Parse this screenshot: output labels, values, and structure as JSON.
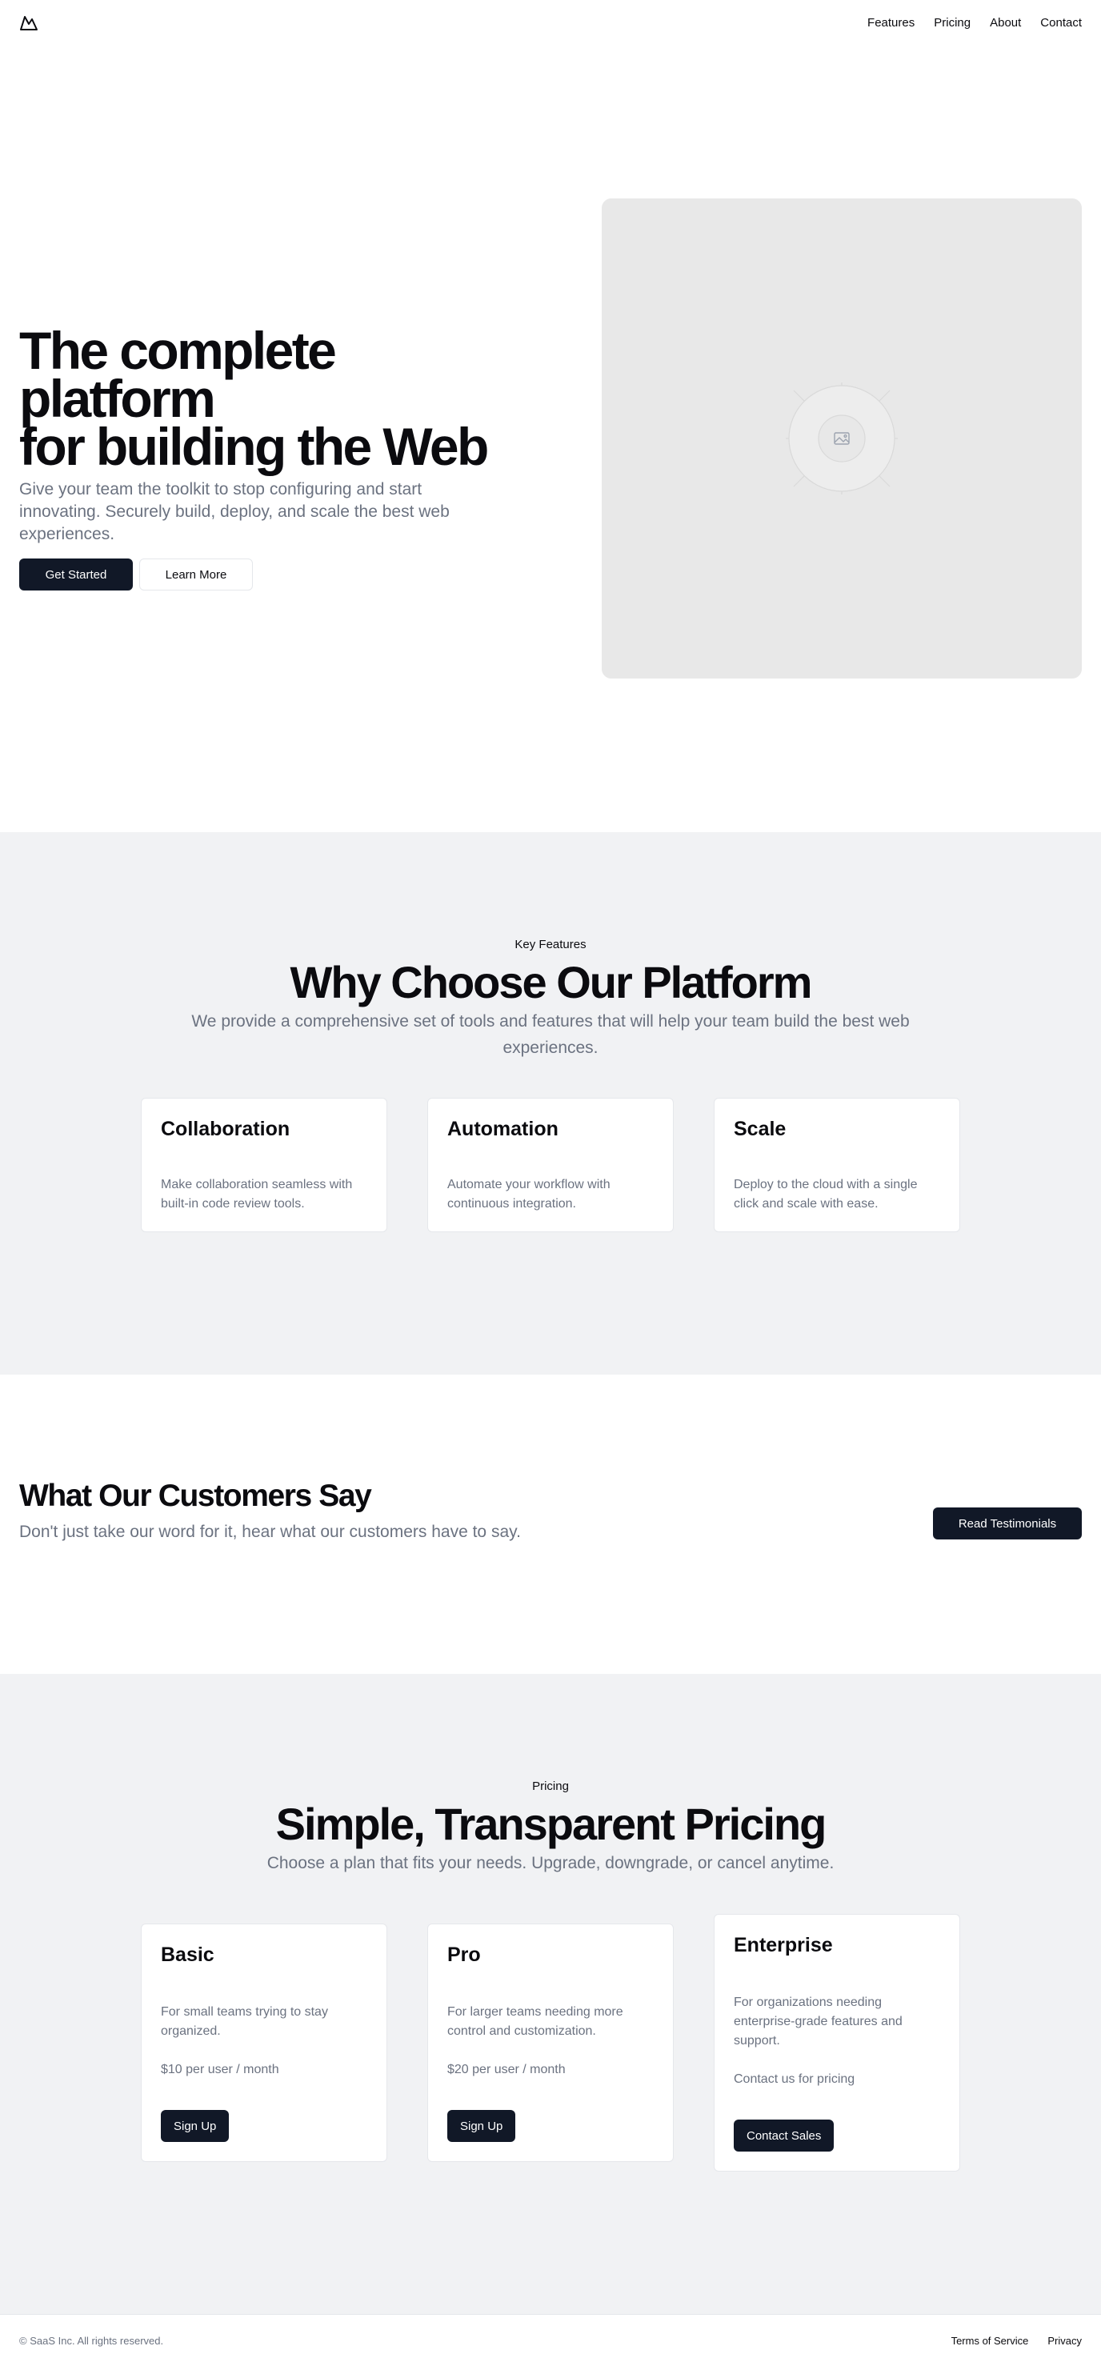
{
  "nav": {
    "logo_icon": "mountain-logo-icon",
    "items": [
      "Features",
      "Pricing",
      "About",
      "Contact"
    ]
  },
  "hero": {
    "title_line1": "The complete platform",
    "title_line2": "for building the Web",
    "subtitle": "Give your team the toolkit to stop configuring and start innovating. Securely build, deploy, and scale the best web experiences.",
    "primary_button": "Get Started",
    "secondary_button": "Learn More",
    "image_icon": "image-placeholder-icon"
  },
  "features": {
    "eyebrow": "Key Features",
    "title": "Why Choose Our Platform",
    "subtitle": "We provide a comprehensive set of tools and features that will help your team build the best web experiences.",
    "cards": [
      {
        "title": "Collaboration",
        "description": "Make collaboration seamless with built-in code review tools."
      },
      {
        "title": "Automation",
        "description": "Automate your workflow with continuous integration."
      },
      {
        "title": "Scale",
        "description": "Deploy to the cloud with a single click and scale with ease."
      }
    ]
  },
  "testimonials": {
    "title": "What Our Customers Say",
    "subtitle": "Don't just take our word for it, hear what our customers have to say.",
    "button": "Read Testimonials"
  },
  "pricing": {
    "eyebrow": "Pricing",
    "title": "Simple, Transparent Pricing",
    "subtitle": "Choose a plan that fits your needs. Upgrade, downgrade, or cancel anytime.",
    "plans": [
      {
        "name": "Basic",
        "description": "For small teams trying to stay organized.",
        "price": "$10 per user / month",
        "button": "Sign Up"
      },
      {
        "name": "Pro",
        "description": "For larger teams needing more control and customization.",
        "price": "$20 per user / month",
        "button": "Sign Up"
      },
      {
        "name": "Enterprise",
        "description": "For organizations needing enterprise-grade features and support.",
        "price": "Contact us for pricing",
        "button": "Contact Sales"
      }
    ]
  },
  "footer": {
    "copyright": "© SaaS Inc. All rights reserved.",
    "links": [
      "Terms of Service",
      "Privacy"
    ]
  },
  "colors": {
    "primary_button": "#111827",
    "muted_text": "#6b7280",
    "section_bg": "#f1f2f4",
    "placeholder_bg": "#e8e8e8"
  }
}
